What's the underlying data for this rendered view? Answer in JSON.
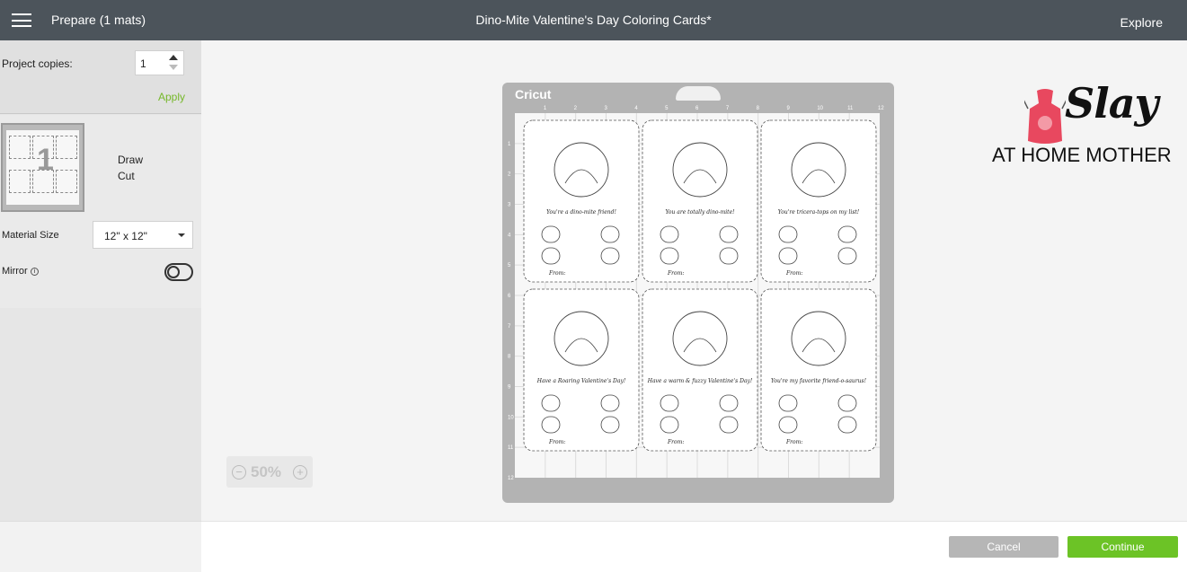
{
  "topbar": {
    "menu_icon": "hamburger-icon",
    "prepare_label": "Prepare (1 mats)",
    "project_title": "Dino-Mite Valentine's Day Coloring Cards*",
    "explore_label": "Explore"
  },
  "sidebar": {
    "copies_label": "Project copies:",
    "copies_value": "1",
    "apply_label": "Apply",
    "mat_number": "1",
    "operations": [
      "Draw",
      "Cut"
    ],
    "material_size_label": "Material Size",
    "material_size_value": "12\" x 12\"",
    "mirror_label": "Mirror",
    "mirror_on": false
  },
  "canvas": {
    "brand": "Cricut",
    "ruler_top": [
      "1",
      "2",
      "3",
      "4",
      "5",
      "6",
      "7",
      "8",
      "9",
      "10",
      "11",
      "12"
    ],
    "ruler_left": [
      "1",
      "2",
      "3",
      "4",
      "5",
      "6",
      "7",
      "8",
      "9",
      "10",
      "11",
      "12"
    ],
    "cards": [
      {
        "caption": "You're a dino-mite friend!",
        "from": "From:"
      },
      {
        "caption": "You are totally dino-mite!",
        "from": "From:"
      },
      {
        "caption": "You're tricera-tops on my list!",
        "from": "From:"
      },
      {
        "caption": "Have a Roaring Valentine's Day!",
        "from": "From:"
      },
      {
        "caption": "Have a warm & fuzzy Valentine's Day!",
        "from": "From:"
      },
      {
        "caption": "You're my favorite friend-o-saurus!",
        "from": "From:"
      }
    ]
  },
  "zoom": {
    "value": "50%",
    "minus_icon": "zoom-out-icon",
    "plus_icon": "zoom-in-icon"
  },
  "footer": {
    "cancel_label": "Cancel",
    "continue_label": "Continue"
  },
  "watermark": {
    "line1": "Slay",
    "line2": "AT HOME MOTHER"
  },
  "colors": {
    "accent_green": "#6cc326",
    "apply_green": "#76b82a",
    "topbar": "#4c545b",
    "logo_red": "#e8485f"
  }
}
